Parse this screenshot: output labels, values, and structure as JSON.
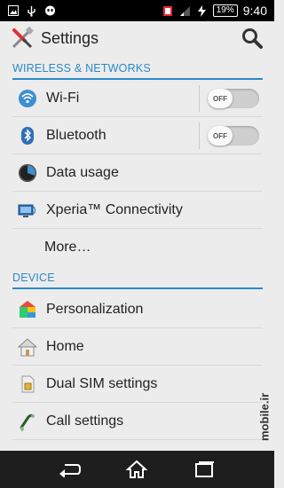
{
  "statusbar": {
    "icons": [
      "image-icon",
      "usb-icon",
      "hangouts-icon",
      "sim-icon",
      "signal-icon",
      "charging-icon"
    ],
    "battery": "19%",
    "time": "9:40"
  },
  "actionbar": {
    "title": "Settings",
    "icon": "settings-tools-icon",
    "search_icon": "search-icon"
  },
  "sections": [
    {
      "header": "WIRELESS & NETWORKS",
      "items": [
        {
          "label": "Wi-Fi",
          "icon": "wifi-icon",
          "toggle": "OFF"
        },
        {
          "label": "Bluetooth",
          "icon": "bluetooth-icon",
          "toggle": "OFF"
        },
        {
          "label": "Data usage",
          "icon": "data-usage-icon"
        },
        {
          "label": "Xperia™ Connectivity",
          "icon": "xperia-connectivity-icon"
        },
        {
          "label": "More…",
          "icon": ""
        }
      ]
    },
    {
      "header": "DEVICE",
      "items": [
        {
          "label": "Personalization",
          "icon": "personalization-icon"
        },
        {
          "label": "Home",
          "icon": "home-icon"
        },
        {
          "label": "Dual SIM settings",
          "icon": "sim-card-icon"
        },
        {
          "label": "Call settings",
          "icon": "phone-icon"
        }
      ]
    }
  ],
  "watermark": "mobile.ir",
  "navbar": {
    "back_icon": "back-icon",
    "home_icon": "home-nav-icon",
    "recents_icon": "recents-icon"
  },
  "colors": {
    "accent": "#2a8ac8",
    "background": "#ececec",
    "navbar": "#1e1e1e"
  }
}
